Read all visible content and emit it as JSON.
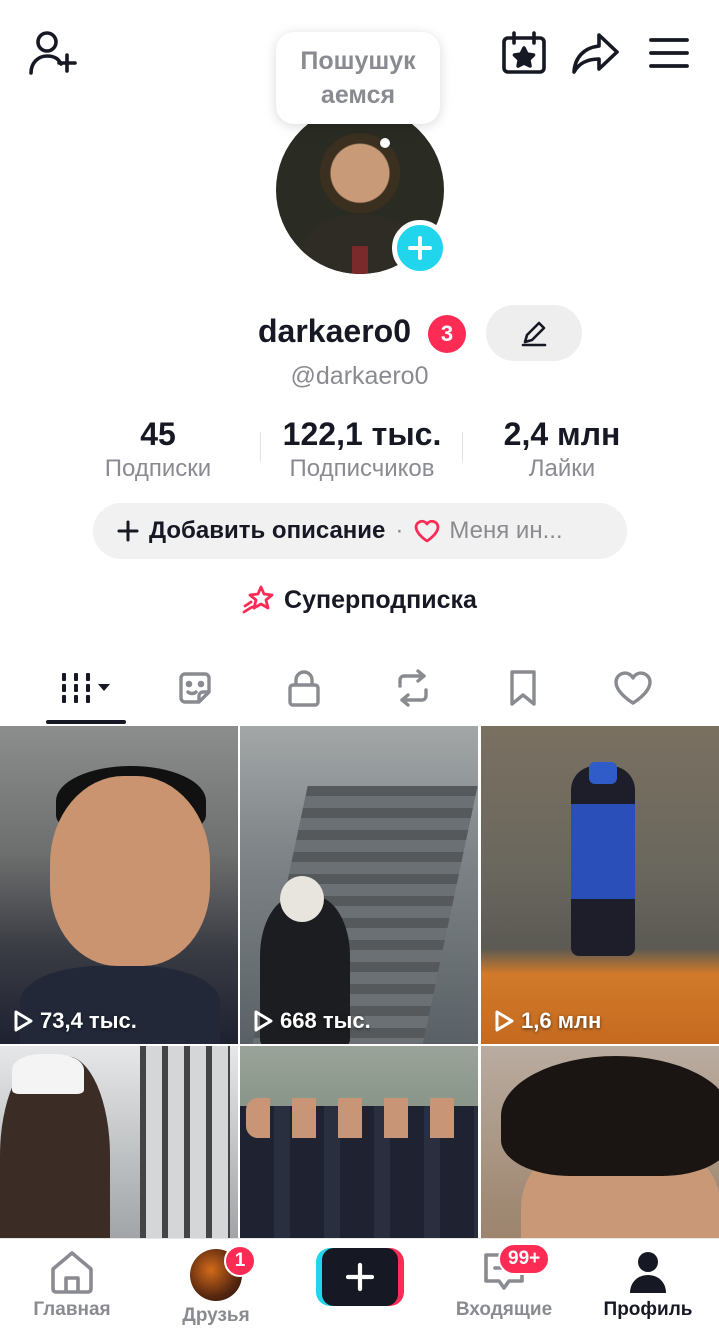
{
  "bubble": {
    "text_line1": "Пошушук",
    "text_line2": "аемся"
  },
  "profile": {
    "username": "darkaero0",
    "badge_count": "3",
    "handle": "@darkaero0"
  },
  "stats": [
    {
      "value": "45",
      "label": "Подписки"
    },
    {
      "value": "122,1 тыс.",
      "label": "Подписчиков"
    },
    {
      "value": "2,4 млн",
      "label": "Лайки"
    }
  ],
  "description": {
    "add_label": "Добавить описание",
    "separator": "·",
    "bio_preview": "Меня ин..."
  },
  "super_subscription": {
    "label": "Суперподписка"
  },
  "tabs": [
    {
      "icon": "grid-icon",
      "active": true
    },
    {
      "icon": "sticker-icon",
      "active": false
    },
    {
      "icon": "lock-icon",
      "active": false
    },
    {
      "icon": "repost-icon",
      "active": false
    },
    {
      "icon": "bookmark-icon",
      "active": false
    },
    {
      "icon": "heart-icon",
      "active": false
    }
  ],
  "videos": [
    {
      "views": "73,4 тыс."
    },
    {
      "views": "668 тыс."
    },
    {
      "views": "1,6 млн"
    },
    {
      "views": ""
    },
    {
      "views": ""
    },
    {
      "views": ""
    }
  ],
  "bottom_nav": {
    "home": "Главная",
    "friends": "Друзья",
    "friends_badge": "1",
    "inbox": "Входящие",
    "inbox_badge": "99+",
    "profile": "Профиль"
  },
  "colors": {
    "accent_red": "#fe2c55",
    "accent_cyan": "#20d5ec",
    "text": "#161823",
    "muted": "#8a8b91"
  }
}
